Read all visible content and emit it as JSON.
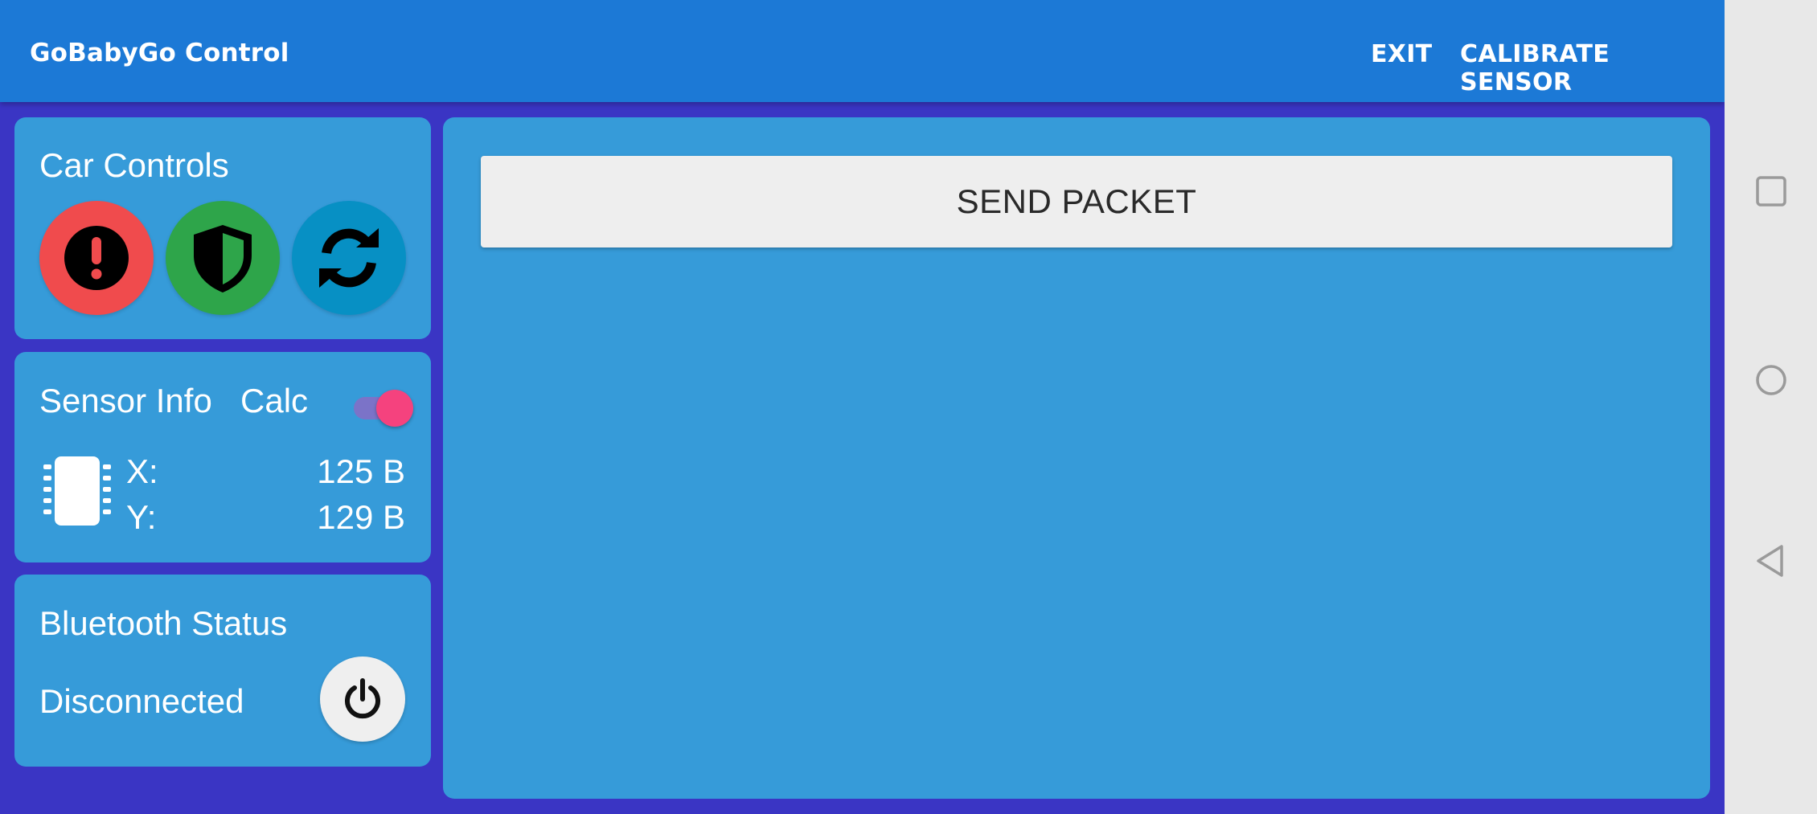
{
  "app": {
    "title": "GoBabyGo Control",
    "actions": {
      "exit": "EXIT",
      "calibrate": "CALIBRATE SENSOR"
    }
  },
  "colors": {
    "appbar": "#1c79d6",
    "background": "#3a35c4",
    "card": "#369bd9",
    "emergency": "#f04b4d",
    "shield": "#2ea54a",
    "refresh": "#0790c4",
    "toggle_on": "#f5427e"
  },
  "car_controls": {
    "title": "Car Controls",
    "buttons": [
      {
        "name": "emergency-stop",
        "icon": "exclamation-circle-icon"
      },
      {
        "name": "shield",
        "icon": "shield-icon"
      },
      {
        "name": "refresh",
        "icon": "sync-icon"
      }
    ]
  },
  "sensor_info": {
    "title": "Sensor Info",
    "calc_label": "Calc",
    "calc_enabled": true,
    "icon": "chip-icon",
    "x_label": "X:",
    "x_value": "125 B",
    "y_label": "Y:",
    "y_value": "129 B"
  },
  "bluetooth": {
    "title": "Bluetooth Status",
    "status": "Disconnected",
    "icon": "power-icon"
  },
  "main": {
    "send_button": "SEND PACKET"
  },
  "navbar": {
    "icons": [
      "recents-icon",
      "home-icon",
      "back-icon"
    ]
  }
}
